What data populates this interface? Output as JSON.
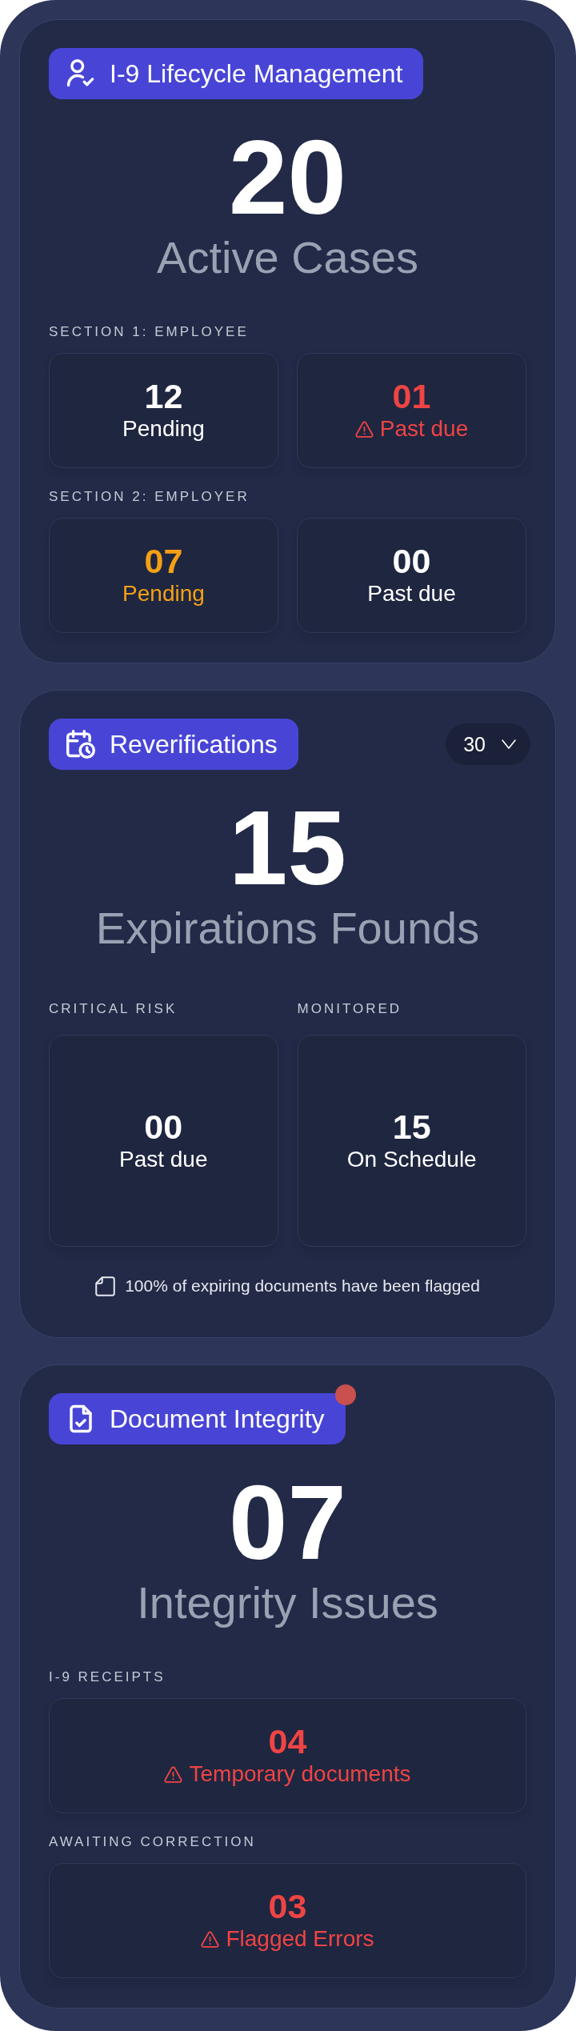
{
  "cards": [
    {
      "kind": "lifecycle",
      "title": "I-9 Lifecycle Management",
      "notification": false,
      "metric": {
        "value": "20",
        "label": "Active Cases"
      },
      "groups": [
        {
          "label": "SECTION 1: EMPLOYEE",
          "tiles": [
            {
              "value": "12",
              "label": "Pending",
              "color": "#ffffff",
              "alert": false
            },
            {
              "value": "01",
              "label": "Past due",
              "color": "#ef4444",
              "alert": true
            }
          ]
        },
        {
          "label": "SECTION 2: EMPLOYER",
          "tiles": [
            {
              "value": "07",
              "label": "Pending",
              "color": "#f5a014",
              "alert": false
            },
            {
              "value": "00",
              "label": "Past due",
              "color": "#ffffff",
              "alert": false
            }
          ]
        }
      ]
    },
    {
      "kind": "reverification",
      "title": "Reverifications",
      "notification": false,
      "period": {
        "value": "30"
      },
      "metric": {
        "value": "15",
        "label": "Expirations Founds"
      },
      "groups": [
        {
          "label": "CRITICAL RISK",
          "tiles": [
            {
              "value": "00",
              "label": "Past due",
              "color": "#ffffff",
              "alert": false
            }
          ]
        },
        {
          "label": "MONITORED",
          "tiles": [
            {
              "value": "15",
              "label": "On Schedule",
              "color": "#ffffff",
              "alert": false
            }
          ]
        }
      ],
      "note": "100% of expiring documents have been flagged"
    },
    {
      "kind": "integrity",
      "title": "Document Integrity",
      "notification": true,
      "metric": {
        "value": "07",
        "label": "Integrity Issues"
      },
      "groups": [
        {
          "label": "I-9 RECEIPTS",
          "tiles": [
            {
              "value": "04",
              "label": "Temporary documents",
              "color": "#ef4444",
              "alert": true
            }
          ]
        },
        {
          "label": "AWAITING CORRECTION",
          "tiles": [
            {
              "value": "03",
              "label": "Flagged Errors",
              "color": "#ef4444",
              "alert": true
            }
          ]
        }
      ]
    }
  ]
}
